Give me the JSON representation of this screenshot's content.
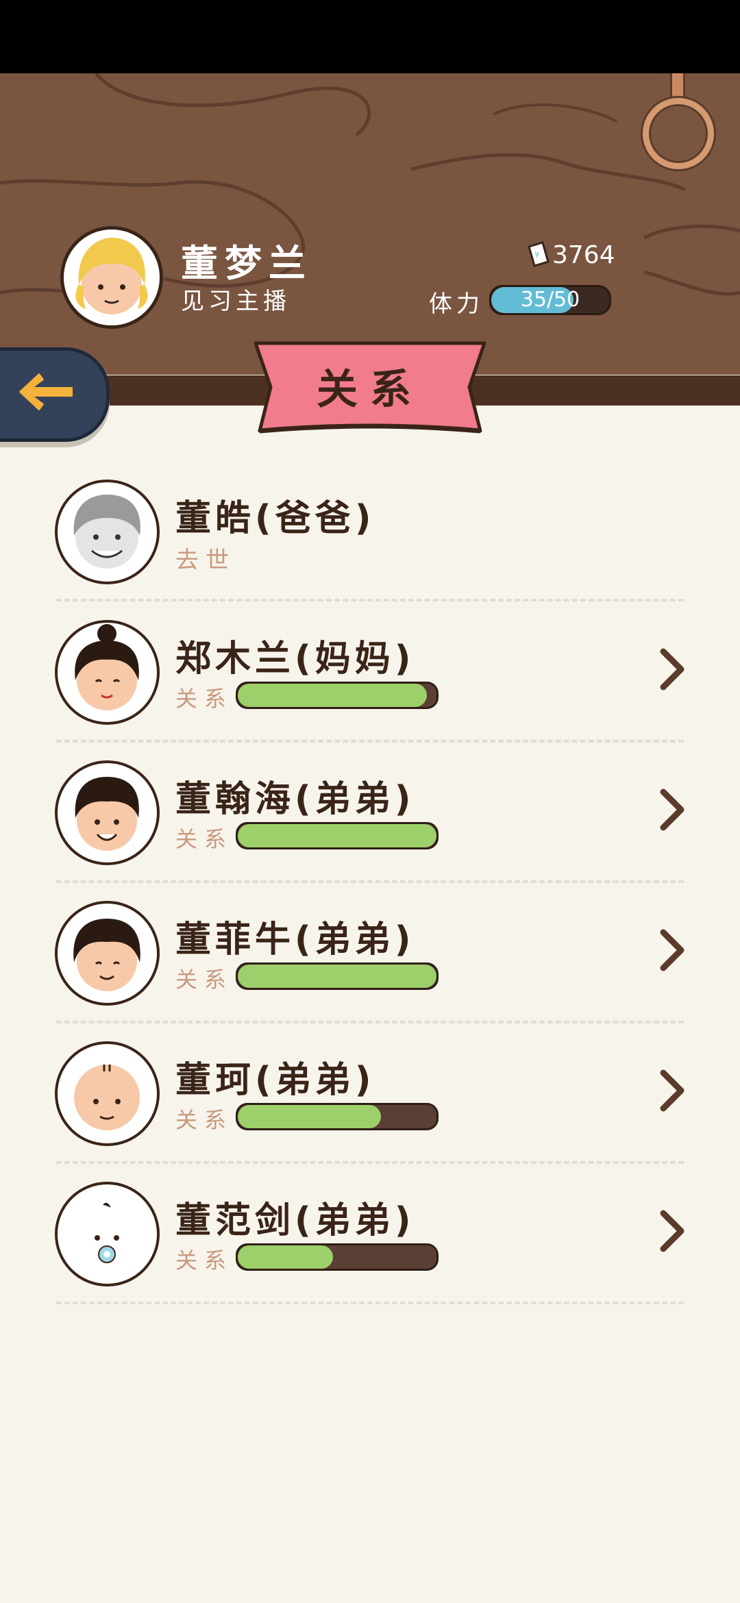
{
  "player": {
    "name": "董梦兰",
    "title": "见习主播",
    "money": "3764",
    "stamina_label": "体力",
    "stamina_text": "35/50",
    "stamina_fraction": 0.7
  },
  "page": {
    "title": "关系"
  },
  "relatives": [
    {
      "name": "董皓(爸爸)",
      "status": "去世",
      "avatar": "grandpa-avatar"
    },
    {
      "name": "郑木兰(妈妈)",
      "rel_label": "关系",
      "relation": 0.95,
      "avatar": "mother-avatar"
    },
    {
      "name": "董翰海(弟弟)",
      "rel_label": "关系",
      "relation": 1.0,
      "avatar": "brother-avatar"
    },
    {
      "name": "董菲牛(弟弟)",
      "rel_label": "关系",
      "relation": 1.0,
      "avatar": "brother-avatar"
    },
    {
      "name": "董珂(弟弟)",
      "rel_label": "关系",
      "relation": 0.72,
      "avatar": "bald-boy-avatar"
    },
    {
      "name": "董范剑(弟弟)",
      "rel_label": "关系",
      "relation": 0.48,
      "avatar": "baby-avatar"
    }
  ],
  "colors": {
    "header_wood": "#7a5540",
    "ribbon": "#f07c8c",
    "relation_fill": "#9dd06a",
    "stamina_fill": "#63bcd6",
    "back_button": "#33425a"
  }
}
